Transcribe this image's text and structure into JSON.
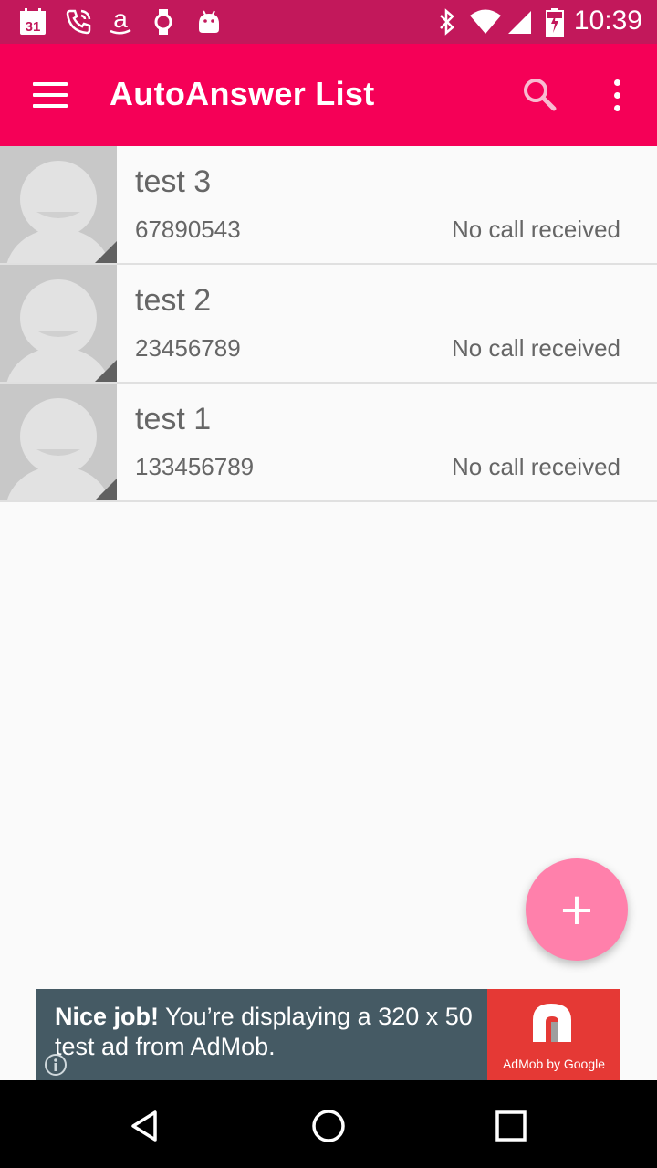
{
  "status_bar": {
    "time": "10:39",
    "calendar_day": "31",
    "left_icons": [
      "calendar-icon",
      "phone-call-icon",
      "amazon-icon",
      "watch-icon",
      "android-icon"
    ],
    "right_icons": [
      "bluetooth-icon",
      "wifi-icon",
      "cell-signal-icon",
      "battery-icon"
    ]
  },
  "app_bar": {
    "title": "AutoAnswer List",
    "icons": [
      "menu-icon",
      "search-icon",
      "more-vert-icon"
    ]
  },
  "contacts": [
    {
      "name": "test 3",
      "number": "67890543",
      "status": "No call received"
    },
    {
      "name": "test 2",
      "number": "23456789",
      "status": "No call received"
    },
    {
      "name": "test 1",
      "number": "133456789",
      "status": "No call received"
    }
  ],
  "fab": {
    "label": "+",
    "icon": "add-icon"
  },
  "ad": {
    "bold": "Nice job!",
    "text": " You’re displaying a 320 x 50 test ad from AdMob.",
    "logo_caption": "AdMob by Google"
  },
  "nav_bar": {
    "icons": [
      "back-icon",
      "home-icon",
      "recents-icon"
    ]
  },
  "colors": {
    "status_bar": "#c2185b",
    "app_bar": "#f50057",
    "fab": "#ff80ab",
    "ad_background": "#455a64",
    "ad_logo": "#e53935",
    "text_secondary": "#666666"
  }
}
